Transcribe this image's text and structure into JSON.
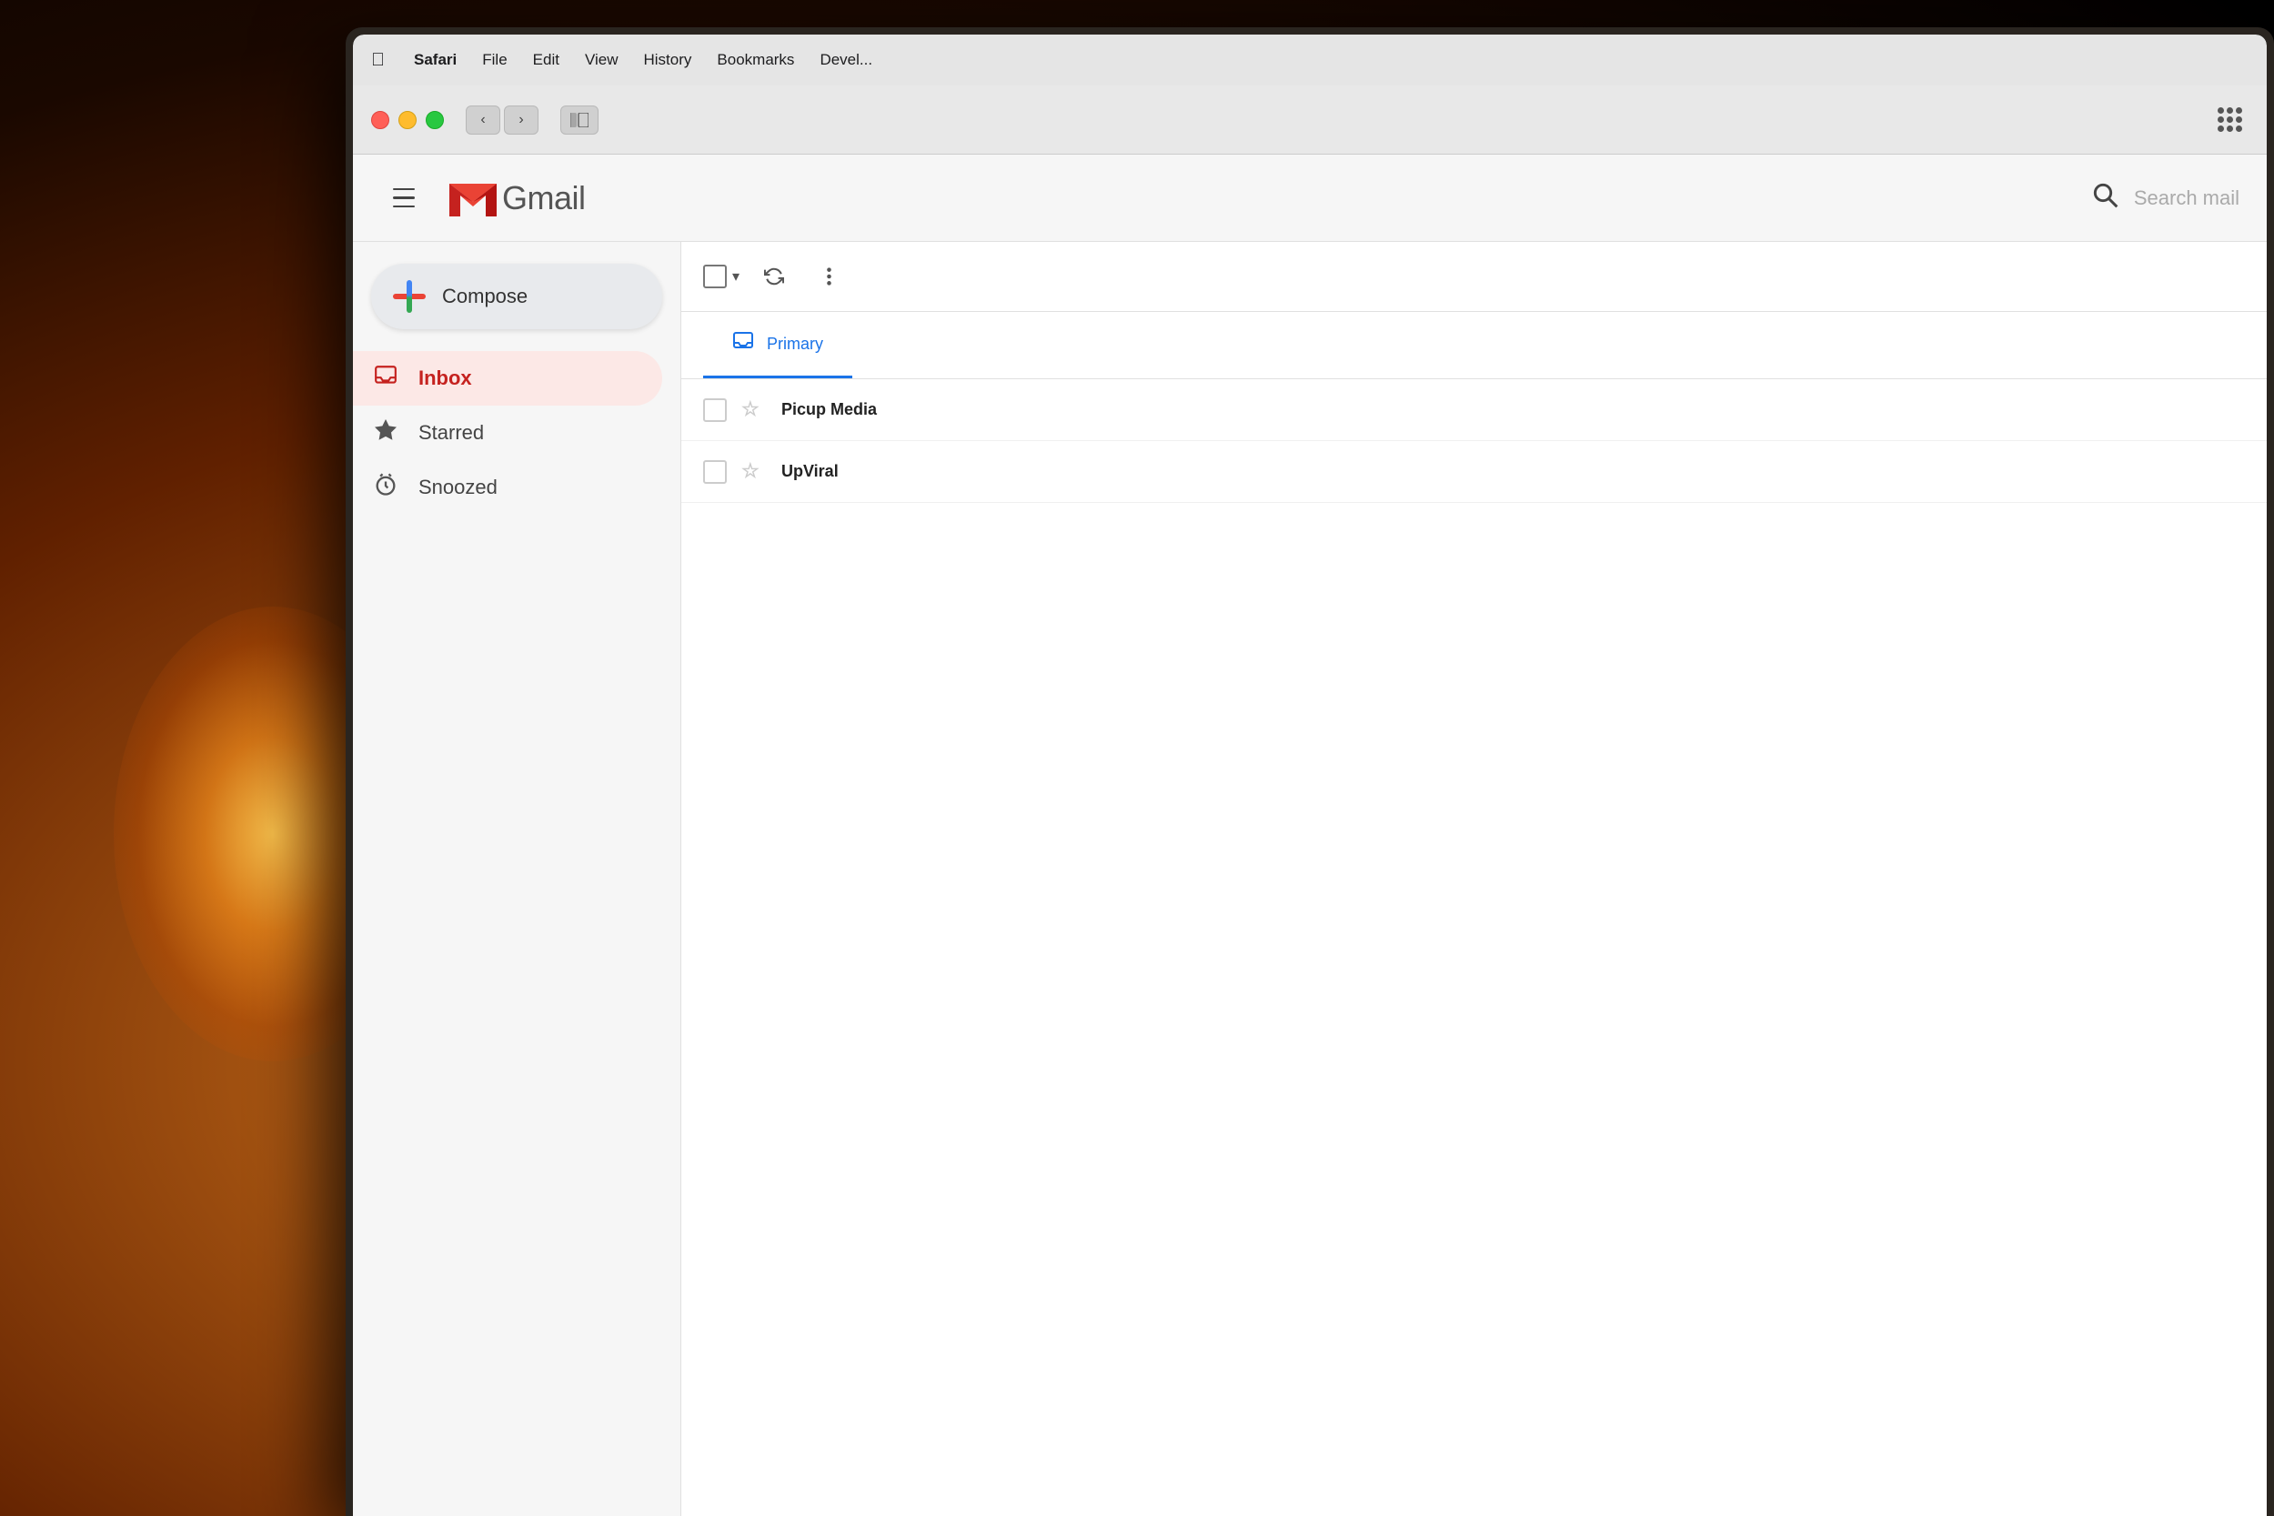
{
  "background": {
    "description": "Blurred photo background with warm amber light"
  },
  "menubar": {
    "apple_symbol": "",
    "items": [
      {
        "label": "Safari",
        "bold": true
      },
      {
        "label": "File"
      },
      {
        "label": "Edit"
      },
      {
        "label": "View"
      },
      {
        "label": "History"
      },
      {
        "label": "Bookmarks"
      },
      {
        "label": "Devel..."
      }
    ]
  },
  "browser": {
    "traffic_lights": [
      "red",
      "yellow",
      "green"
    ],
    "nav": {
      "back_label": "‹",
      "forward_label": "›"
    },
    "sidebar_toggle_icon": "sidebar-icon",
    "grid_icon": "grid-icon"
  },
  "gmail": {
    "header": {
      "menu_icon": "hamburger-icon",
      "logo_m": "M",
      "logo_text": "Gmail",
      "search_placeholder": "Search mail",
      "search_icon": "search-icon"
    },
    "sidebar": {
      "compose_label": "Compose",
      "nav_items": [
        {
          "id": "inbox",
          "label": "Inbox",
          "icon": "inbox-icon",
          "active": true
        },
        {
          "id": "starred",
          "label": "Starred",
          "icon": "star-icon",
          "active": false
        },
        {
          "id": "snoozed",
          "label": "Snoozed",
          "icon": "snoozed-icon",
          "active": false
        }
      ]
    },
    "toolbar": {
      "select_all_label": "Select all",
      "refresh_icon": "refresh-icon",
      "more_icon": "more-icon"
    },
    "tabs": [
      {
        "id": "primary",
        "label": "Primary",
        "icon": "inbox-tab-icon",
        "active": true
      }
    ],
    "emails": [
      {
        "sender": "Picup Media",
        "starred": false
      },
      {
        "sender": "UpViral",
        "starred": false
      }
    ]
  }
}
